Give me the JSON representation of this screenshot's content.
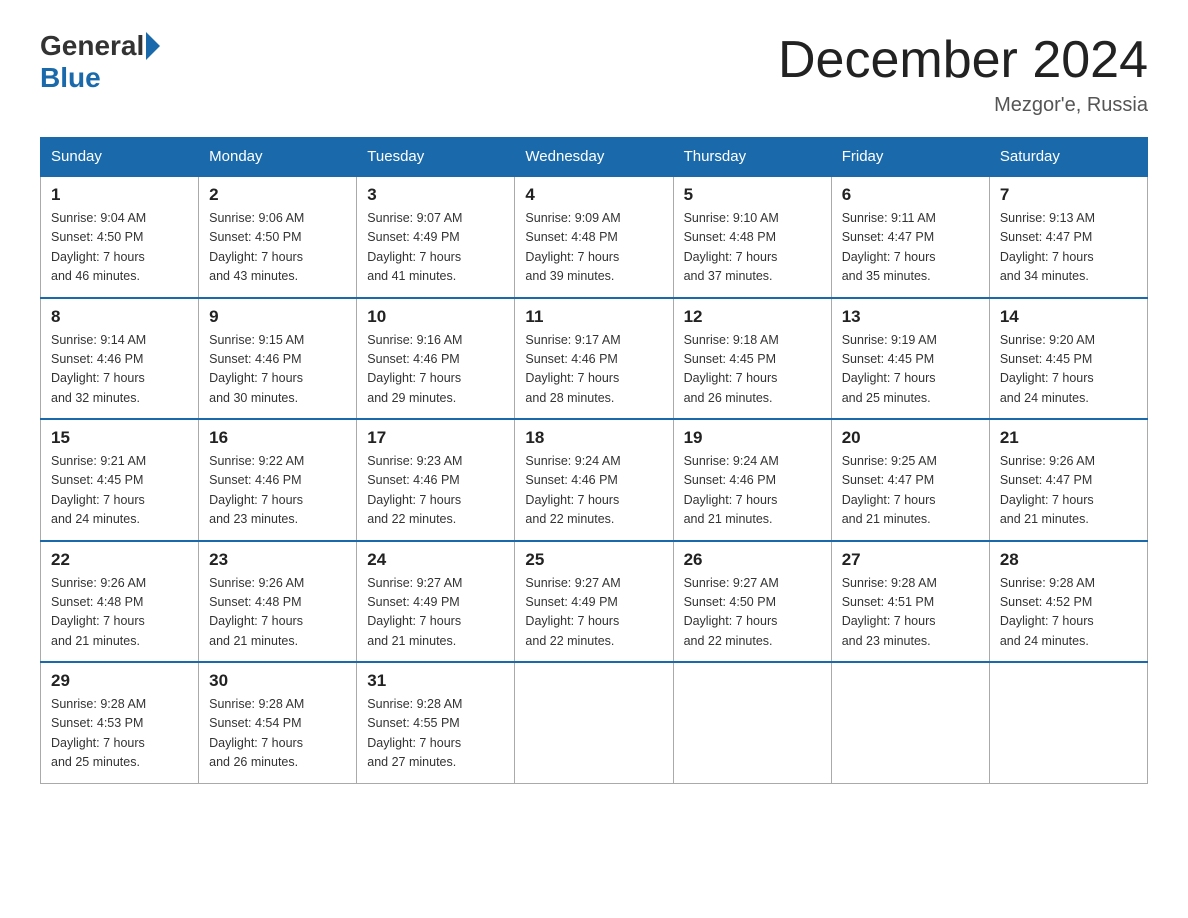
{
  "logo": {
    "general": "General",
    "blue": "Blue",
    "underline": "Blue"
  },
  "header": {
    "month_title": "December 2024",
    "location": "Mezgor'e, Russia"
  },
  "days_of_week": [
    "Sunday",
    "Monday",
    "Tuesday",
    "Wednesday",
    "Thursday",
    "Friday",
    "Saturday"
  ],
  "weeks": [
    [
      {
        "day": "1",
        "info": "Sunrise: 9:04 AM\nSunset: 4:50 PM\nDaylight: 7 hours\nand 46 minutes."
      },
      {
        "day": "2",
        "info": "Sunrise: 9:06 AM\nSunset: 4:50 PM\nDaylight: 7 hours\nand 43 minutes."
      },
      {
        "day": "3",
        "info": "Sunrise: 9:07 AM\nSunset: 4:49 PM\nDaylight: 7 hours\nand 41 minutes."
      },
      {
        "day": "4",
        "info": "Sunrise: 9:09 AM\nSunset: 4:48 PM\nDaylight: 7 hours\nand 39 minutes."
      },
      {
        "day": "5",
        "info": "Sunrise: 9:10 AM\nSunset: 4:48 PM\nDaylight: 7 hours\nand 37 minutes."
      },
      {
        "day": "6",
        "info": "Sunrise: 9:11 AM\nSunset: 4:47 PM\nDaylight: 7 hours\nand 35 minutes."
      },
      {
        "day": "7",
        "info": "Sunrise: 9:13 AM\nSunset: 4:47 PM\nDaylight: 7 hours\nand 34 minutes."
      }
    ],
    [
      {
        "day": "8",
        "info": "Sunrise: 9:14 AM\nSunset: 4:46 PM\nDaylight: 7 hours\nand 32 minutes."
      },
      {
        "day": "9",
        "info": "Sunrise: 9:15 AM\nSunset: 4:46 PM\nDaylight: 7 hours\nand 30 minutes."
      },
      {
        "day": "10",
        "info": "Sunrise: 9:16 AM\nSunset: 4:46 PM\nDaylight: 7 hours\nand 29 minutes."
      },
      {
        "day": "11",
        "info": "Sunrise: 9:17 AM\nSunset: 4:46 PM\nDaylight: 7 hours\nand 28 minutes."
      },
      {
        "day": "12",
        "info": "Sunrise: 9:18 AM\nSunset: 4:45 PM\nDaylight: 7 hours\nand 26 minutes."
      },
      {
        "day": "13",
        "info": "Sunrise: 9:19 AM\nSunset: 4:45 PM\nDaylight: 7 hours\nand 25 minutes."
      },
      {
        "day": "14",
        "info": "Sunrise: 9:20 AM\nSunset: 4:45 PM\nDaylight: 7 hours\nand 24 minutes."
      }
    ],
    [
      {
        "day": "15",
        "info": "Sunrise: 9:21 AM\nSunset: 4:45 PM\nDaylight: 7 hours\nand 24 minutes."
      },
      {
        "day": "16",
        "info": "Sunrise: 9:22 AM\nSunset: 4:46 PM\nDaylight: 7 hours\nand 23 minutes."
      },
      {
        "day": "17",
        "info": "Sunrise: 9:23 AM\nSunset: 4:46 PM\nDaylight: 7 hours\nand 22 minutes."
      },
      {
        "day": "18",
        "info": "Sunrise: 9:24 AM\nSunset: 4:46 PM\nDaylight: 7 hours\nand 22 minutes."
      },
      {
        "day": "19",
        "info": "Sunrise: 9:24 AM\nSunset: 4:46 PM\nDaylight: 7 hours\nand 21 minutes."
      },
      {
        "day": "20",
        "info": "Sunrise: 9:25 AM\nSunset: 4:47 PM\nDaylight: 7 hours\nand 21 minutes."
      },
      {
        "day": "21",
        "info": "Sunrise: 9:26 AM\nSunset: 4:47 PM\nDaylight: 7 hours\nand 21 minutes."
      }
    ],
    [
      {
        "day": "22",
        "info": "Sunrise: 9:26 AM\nSunset: 4:48 PM\nDaylight: 7 hours\nand 21 minutes."
      },
      {
        "day": "23",
        "info": "Sunrise: 9:26 AM\nSunset: 4:48 PM\nDaylight: 7 hours\nand 21 minutes."
      },
      {
        "day": "24",
        "info": "Sunrise: 9:27 AM\nSunset: 4:49 PM\nDaylight: 7 hours\nand 21 minutes."
      },
      {
        "day": "25",
        "info": "Sunrise: 9:27 AM\nSunset: 4:49 PM\nDaylight: 7 hours\nand 22 minutes."
      },
      {
        "day": "26",
        "info": "Sunrise: 9:27 AM\nSunset: 4:50 PM\nDaylight: 7 hours\nand 22 minutes."
      },
      {
        "day": "27",
        "info": "Sunrise: 9:28 AM\nSunset: 4:51 PM\nDaylight: 7 hours\nand 23 minutes."
      },
      {
        "day": "28",
        "info": "Sunrise: 9:28 AM\nSunset: 4:52 PM\nDaylight: 7 hours\nand 24 minutes."
      }
    ],
    [
      {
        "day": "29",
        "info": "Sunrise: 9:28 AM\nSunset: 4:53 PM\nDaylight: 7 hours\nand 25 minutes."
      },
      {
        "day": "30",
        "info": "Sunrise: 9:28 AM\nSunset: 4:54 PM\nDaylight: 7 hours\nand 26 minutes."
      },
      {
        "day": "31",
        "info": "Sunrise: 9:28 AM\nSunset: 4:55 PM\nDaylight: 7 hours\nand 27 minutes."
      },
      {
        "day": "",
        "info": ""
      },
      {
        "day": "",
        "info": ""
      },
      {
        "day": "",
        "info": ""
      },
      {
        "day": "",
        "info": ""
      }
    ]
  ]
}
